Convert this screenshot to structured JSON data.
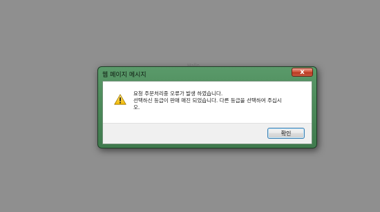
{
  "background": {
    "faint_text": "Hallo..."
  },
  "dialog": {
    "title": "웹 페이지 메시지",
    "close_label": "x",
    "icon": "warning-icon",
    "message_lines": [
      "요청 주문처리중 오류가 발생 하였습니다.",
      "선택하신 등급이 판매 매진 되었습니다. 다른 등급을 선택하여 주십시",
      "오."
    ],
    "ok_label": "확인"
  },
  "colors": {
    "frame_green": "#4e8c5c",
    "close_red": "#c84a30",
    "button_focus": "#3c7fb1"
  }
}
